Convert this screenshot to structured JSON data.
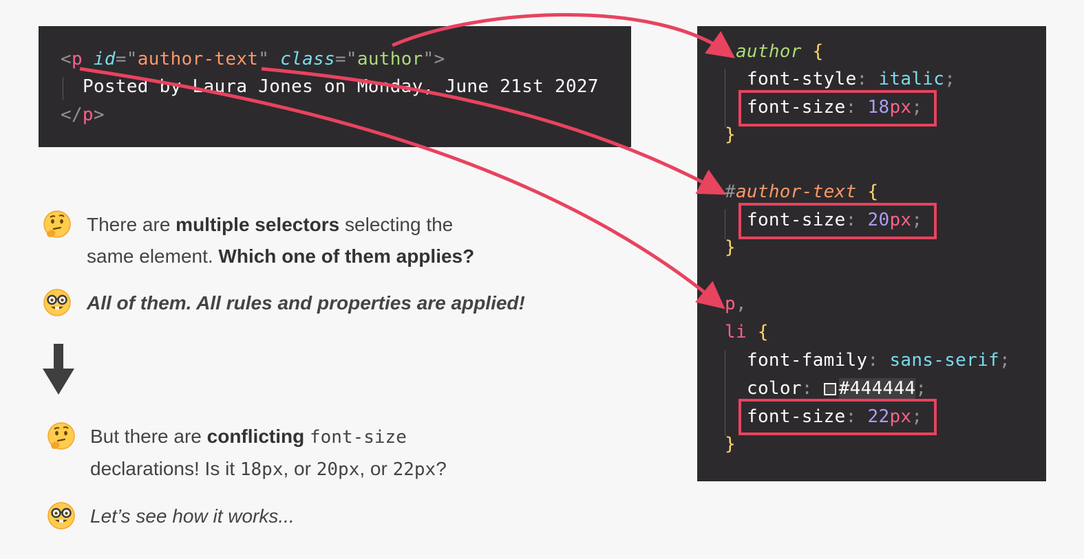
{
  "html_snippet": {
    "open_lt": "<",
    "tag": "p",
    "attr_id": "id",
    "eq1": "=\"",
    "id_value": "author-text",
    "q1": "\"",
    "attr_class": "class",
    "eq2": "=\"",
    "class_value": "author",
    "close_gt": "\">",
    "content": "Posted by Laura Jones on Monday, June 21st 2027",
    "close_lt": "</",
    "close_tag": "p",
    "close_gt2": ">"
  },
  "css_snippet": {
    "rule1_selector_dot": ".",
    "rule1_selector": "author",
    "rule1_p1_name": "font-style",
    "rule1_p1_value": "italic",
    "rule1_p2_name": "font-size",
    "rule1_p2_num": "18",
    "rule1_p2_unit": "px",
    "rule2_selector_hash": "#",
    "rule2_selector": "author-text",
    "rule2_p1_name": "font-size",
    "rule2_p1_num": "20",
    "rule2_p1_unit": "px",
    "rule3_selector_a": "p",
    "rule3_selector_b": "li",
    "rule3_p1_name": "font-family",
    "rule3_p1_value": "sans-serif",
    "rule3_p2_name": "color",
    "rule3_p2_value": "#444444",
    "rule3_p3_name": "font-size",
    "rule3_p3_num": "22",
    "rule3_p3_unit": "px",
    "open_brace": "{",
    "close_brace": "}",
    "colon": ":",
    "semicolon": ";",
    "comma": ","
  },
  "text": {
    "q1_pre": "There are ",
    "q1_bold": "multiple selectors",
    "q1_post": " selecting the",
    "q1_line2_pre": "same element. ",
    "q1_line2_bold": "Which one of them applies?",
    "a1": "All of them. All rules and properties are applied!",
    "q2_pre": "But there are ",
    "q2_bold": "conflicting",
    "q2_code": "font-size",
    "q2_line2_pre": "declarations! Is it ",
    "q2_code1": "18px",
    "q2_sep1": ", or ",
    "q2_code2": "20px",
    "q2_sep2": ", or ",
    "q2_code3": "22px",
    "q2_end": "?",
    "a2": "Let’s see how it works..."
  },
  "icons": {
    "thinking": "thinking-face-icon",
    "nerd": "nerd-face-icon",
    "arrow": "down-arrow-icon"
  },
  "colors": {
    "arrow": "#e8435f",
    "code_bg": "#2d2a2e",
    "page_bg": "#f7f7f7"
  }
}
